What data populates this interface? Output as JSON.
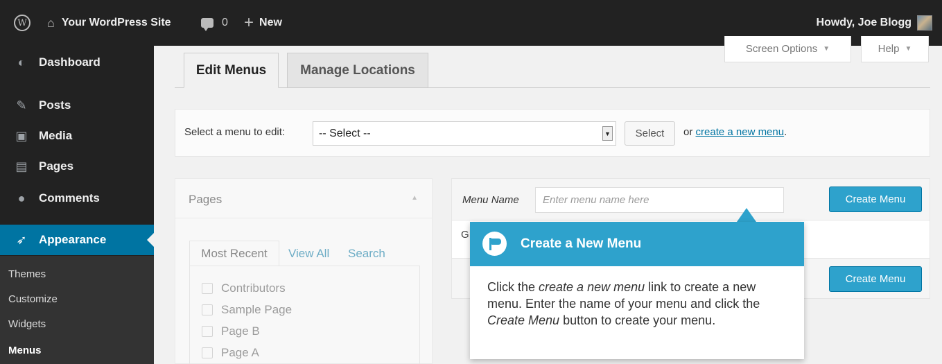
{
  "admin_bar": {
    "site_name": "Your WordPress Site",
    "comments_count": "0",
    "new_label": "New",
    "greeting": "Howdy, Joe Blogg"
  },
  "sidebar": {
    "items": [
      {
        "label": "Dashboard",
        "icon": "dashboard-icon"
      },
      {
        "label": "Posts",
        "icon": "pin-icon"
      },
      {
        "label": "Media",
        "icon": "media-icon"
      },
      {
        "label": "Pages",
        "icon": "pages-icon"
      },
      {
        "label": "Comments",
        "icon": "comments-icon"
      },
      {
        "label": "Appearance",
        "icon": "brush-icon"
      }
    ],
    "submenu": [
      "Themes",
      "Customize",
      "Widgets",
      "Menus"
    ]
  },
  "header_buttons": {
    "screen_options": "Screen Options",
    "help": "Help"
  },
  "tabs": [
    "Edit Menus",
    "Manage Locations"
  ],
  "select_panel": {
    "label": "Select a menu to edit:",
    "dropdown_value": "-- Select --",
    "button": "Select",
    "or_text": "or",
    "link_text": "create a new menu",
    "period": "."
  },
  "pages_panel": {
    "title": "Pages",
    "tabs": [
      "Most Recent",
      "View All",
      "Search"
    ],
    "items": [
      "Contributors",
      "Sample Page",
      "Page B",
      "Page A"
    ]
  },
  "menu_panel": {
    "name_label": "Menu Name",
    "name_placeholder": "Enter menu name here",
    "create_button": "Create Menu",
    "body_text": "G"
  },
  "pointer": {
    "title": "Create a New Menu",
    "body_pre": "Click the ",
    "body_em1": "create a new menu",
    "body_mid": " link to create a new menu. Enter the name of your menu and click the ",
    "body_em2": "Create Menu",
    "body_post": " button to create your menu."
  },
  "colors": {
    "admin_dark": "#222222",
    "active_blue": "#0074a2",
    "button_blue": "#2ea2cc",
    "content_bg": "#f1f1f1"
  }
}
